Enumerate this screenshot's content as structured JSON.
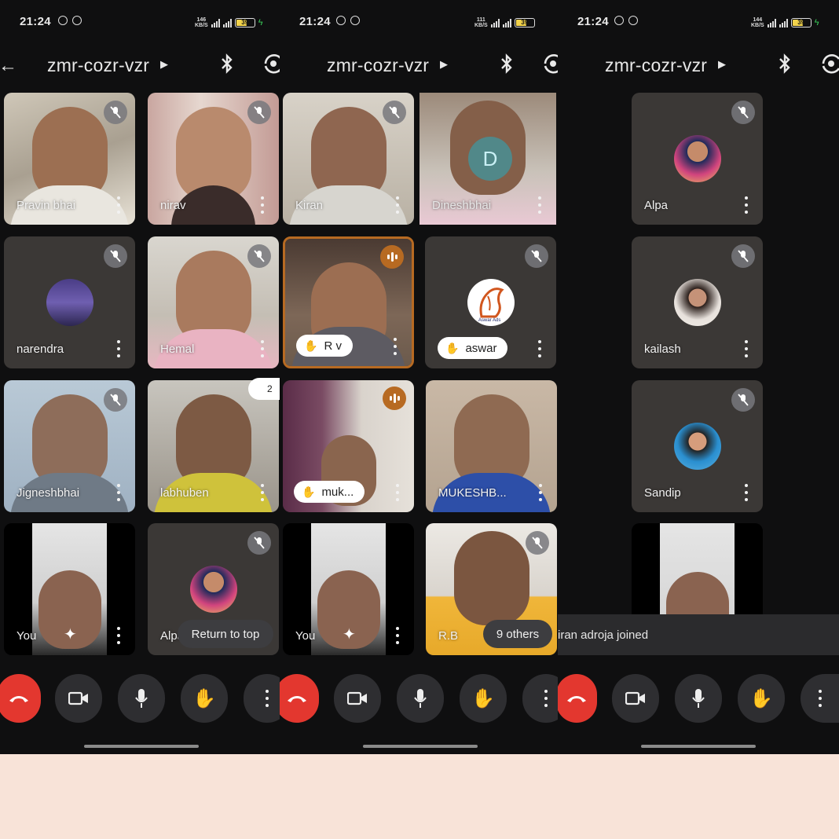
{
  "meeting_code": "zmr-cozr-vzr",
  "screens": [
    {
      "time": "21:24",
      "net_speed_value": "146",
      "net_speed_unit": "KB/S",
      "battery": "39"
    },
    {
      "time": "21:24",
      "net_speed_value": "111",
      "net_speed_unit": "KB/S",
      "battery": "39"
    },
    {
      "time": "21:24",
      "net_speed_value": "144",
      "net_speed_unit": "KB/S",
      "battery": "39"
    }
  ],
  "participants": {
    "pravin": "Pravin bhai",
    "nirav": "nirav",
    "kiran": "Kiran",
    "dinesh": "Dineshbhai",
    "narendra": "narendra",
    "hemal": "Hemal",
    "rv": "R v",
    "aswar": "aswar",
    "jignesh": "Jigneshbhai",
    "labhuben": "labhuben",
    "muk": "muk...",
    "mukesh": "MUKESHB...",
    "you": "You",
    "alpa_short": "Alpa",
    "rb": "R.B",
    "alpa": "Alpa",
    "kailash": "kailash",
    "sandip": "Sandip"
  },
  "dinesh_initial": "D",
  "aswar_logo_text": "Aswar Ads",
  "raised_hand_count": "2",
  "return_to_top": "Return to top",
  "others_label": "9 others",
  "toast_text": "iran adroja joined",
  "colors": {
    "screen_bg": "#0f0f10",
    "tile_bg": "#3b3836",
    "end_call": "#e3372f",
    "speaking_accent": "#b76a22",
    "page_bg": "#f8e3d8"
  }
}
